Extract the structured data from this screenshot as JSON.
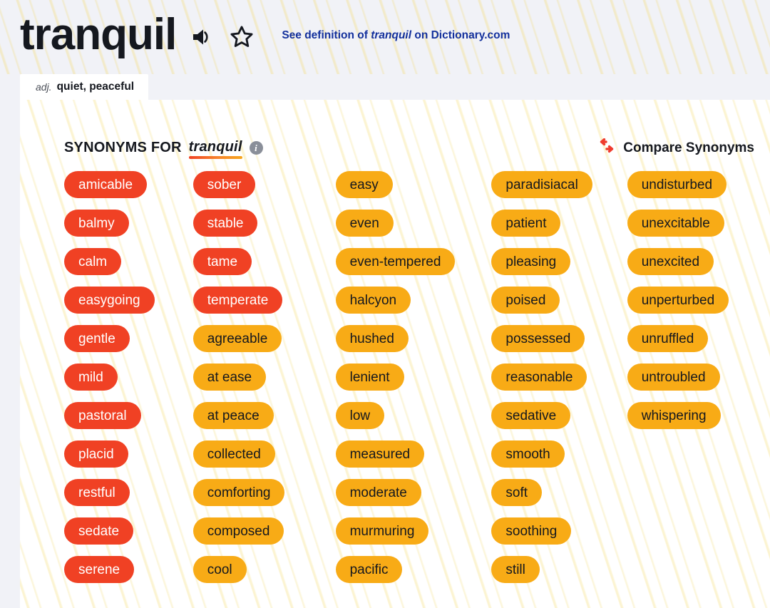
{
  "header": {
    "word": "tranquil",
    "speaker_icon": "speaker-icon",
    "favorite_icon": "star-outline-icon",
    "see_definition_prefix": "See definition of ",
    "see_definition_word": "tranquil",
    "see_definition_suffix": " on Dictionary.com"
  },
  "pos_tab": {
    "abbr": "adj.",
    "definitions": "quiet, peaceful"
  },
  "section": {
    "title_prefix": "SYNONYMS FOR ",
    "title_word": "tranquil",
    "info_icon": "info-icon",
    "info_glyph": "i",
    "compare_icon": "compare-arrows-icon",
    "compare_label": "Compare Synonyms"
  },
  "colors": {
    "strong_chip_bg": "#f04124",
    "strong_chip_text": "#ffffff",
    "mild_chip_bg": "#f8ab16",
    "mild_chip_text": "#15181f",
    "link": "#13309c",
    "page_bg": "#f1f2f7",
    "card_bg": "#ffffff",
    "info_icon_bg": "#8a8f99",
    "compare_icon": "#ef3b2d"
  },
  "columns": [
    {
      "chips": [
        {
          "label": "amicable",
          "strength": "strong"
        },
        {
          "label": "balmy",
          "strength": "strong"
        },
        {
          "label": "calm",
          "strength": "strong"
        },
        {
          "label": "easygoing",
          "strength": "strong"
        },
        {
          "label": "gentle",
          "strength": "strong"
        },
        {
          "label": "mild",
          "strength": "strong"
        },
        {
          "label": "pastoral",
          "strength": "strong"
        },
        {
          "label": "placid",
          "strength": "strong"
        },
        {
          "label": "restful",
          "strength": "strong"
        },
        {
          "label": "sedate",
          "strength": "strong"
        },
        {
          "label": "serene",
          "strength": "strong"
        }
      ]
    },
    {
      "chips": [
        {
          "label": "sober",
          "strength": "strong"
        },
        {
          "label": "stable",
          "strength": "strong"
        },
        {
          "label": "tame",
          "strength": "strong"
        },
        {
          "label": "temperate",
          "strength": "strong"
        },
        {
          "label": "agreeable",
          "strength": "mild"
        },
        {
          "label": "at ease",
          "strength": "mild"
        },
        {
          "label": "at peace",
          "strength": "mild"
        },
        {
          "label": "collected",
          "strength": "mild"
        },
        {
          "label": "comforting",
          "strength": "mild"
        },
        {
          "label": "composed",
          "strength": "mild"
        },
        {
          "label": "cool",
          "strength": "mild"
        }
      ]
    },
    {
      "chips": [
        {
          "label": "easy",
          "strength": "mild"
        },
        {
          "label": "even",
          "strength": "mild"
        },
        {
          "label": "even-tempered",
          "strength": "mild"
        },
        {
          "label": "halcyon",
          "strength": "mild"
        },
        {
          "label": "hushed",
          "strength": "mild"
        },
        {
          "label": "lenient",
          "strength": "mild"
        },
        {
          "label": "low",
          "strength": "mild"
        },
        {
          "label": "measured",
          "strength": "mild"
        },
        {
          "label": "moderate",
          "strength": "mild"
        },
        {
          "label": "murmuring",
          "strength": "mild"
        },
        {
          "label": "pacific",
          "strength": "mild"
        }
      ]
    },
    {
      "chips": [
        {
          "label": "paradisiacal",
          "strength": "mild"
        },
        {
          "label": "patient",
          "strength": "mild"
        },
        {
          "label": "pleasing",
          "strength": "mild"
        },
        {
          "label": "poised",
          "strength": "mild"
        },
        {
          "label": "possessed",
          "strength": "mild"
        },
        {
          "label": "reasonable",
          "strength": "mild"
        },
        {
          "label": "sedative",
          "strength": "mild"
        },
        {
          "label": "smooth",
          "strength": "mild"
        },
        {
          "label": "soft",
          "strength": "mild"
        },
        {
          "label": "soothing",
          "strength": "mild"
        },
        {
          "label": "still",
          "strength": "mild"
        }
      ]
    },
    {
      "chips": [
        {
          "label": "undisturbed",
          "strength": "mild"
        },
        {
          "label": "unexcitable",
          "strength": "mild"
        },
        {
          "label": "unexcited",
          "strength": "mild"
        },
        {
          "label": "unperturbed",
          "strength": "mild"
        },
        {
          "label": "unruffled",
          "strength": "mild"
        },
        {
          "label": "untroubled",
          "strength": "mild"
        },
        {
          "label": "whispering",
          "strength": "mild"
        }
      ]
    }
  ]
}
